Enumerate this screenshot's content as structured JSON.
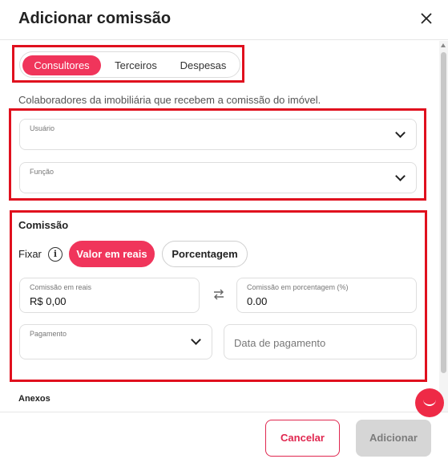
{
  "modal": {
    "title": "Adicionar comissão",
    "close_icon": "close-icon"
  },
  "tabs": [
    {
      "label": "Consultores",
      "active": true
    },
    {
      "label": "Terceiros",
      "active": false
    },
    {
      "label": "Despesas",
      "active": false
    }
  ],
  "description": "Colaboradores da imobiliária que recebem a comissão do imóvel.",
  "fields": {
    "usuario": {
      "label": "Usuário"
    },
    "funcao": {
      "label": "Função"
    }
  },
  "commission": {
    "title": "Comissão",
    "fixar_label": "Fixar",
    "info_icon": "i",
    "options": {
      "reais": "Valor em reais",
      "porcentagem": "Porcentagem"
    },
    "selected": "reais",
    "reais_field": {
      "label": "Comissão em reais",
      "value": "R$ 0,00"
    },
    "porcentagem_field": {
      "label": "Comissão em porcentagem (%)",
      "value": "0.00"
    },
    "pagamento": {
      "label": "Pagamento"
    },
    "data_pagamento": {
      "placeholder": "Data de pagamento"
    }
  },
  "anexos": {
    "title": "Anexos"
  },
  "footer": {
    "cancel_label": "Cancelar",
    "add_label": "Adicionar"
  },
  "colors": {
    "accent": "#f0355b",
    "highlight_border": "#e0101e",
    "disabled_button": "#d6d6d6"
  }
}
